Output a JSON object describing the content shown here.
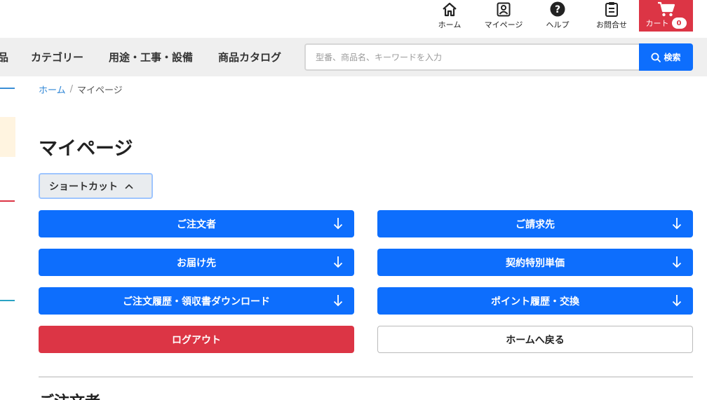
{
  "header": {
    "nav": [
      {
        "label": "ホーム",
        "icon": "home-icon"
      },
      {
        "label": "マイページ",
        "icon": "user-icon"
      },
      {
        "label": "ヘルプ",
        "icon": "help-icon"
      },
      {
        "label": "お問合せ",
        "icon": "clipboard-icon"
      }
    ],
    "cart": {
      "label": "カート",
      "count": "0",
      "icon": "cart-icon"
    }
  },
  "navbar": {
    "items": [
      "品",
      "カテゴリー",
      "用途・工事・設備",
      "商品カタログ"
    ],
    "search": {
      "placeholder": "型番、商品名、キーワードを入力",
      "value": "",
      "button_label": "検索"
    }
  },
  "breadcrumb": {
    "home": "ホーム",
    "separator": "/",
    "current": "マイページ"
  },
  "page_title": "マイページ",
  "shortcut": {
    "label": "ショートカット",
    "expanded": true
  },
  "shortcut_buttons": [
    {
      "label": "ご注文者",
      "style": "blue"
    },
    {
      "label": "ご請求先",
      "style": "blue"
    },
    {
      "label": "お届け先",
      "style": "blue"
    },
    {
      "label": "契約特別単価",
      "style": "blue"
    },
    {
      "label": "ご注文履歴・領収書ダウンロード",
      "style": "blue"
    },
    {
      "label": "ポイント履歴・交換",
      "style": "blue"
    }
  ],
  "actions": {
    "logout": "ログアウト",
    "back_home": "ホームへ戻る"
  },
  "section_heading": "ご注文者",
  "colors": {
    "primary": "#0d6efd",
    "danger": "#dc3545",
    "nav_bg": "#efefef",
    "link": "#2f86d6"
  }
}
